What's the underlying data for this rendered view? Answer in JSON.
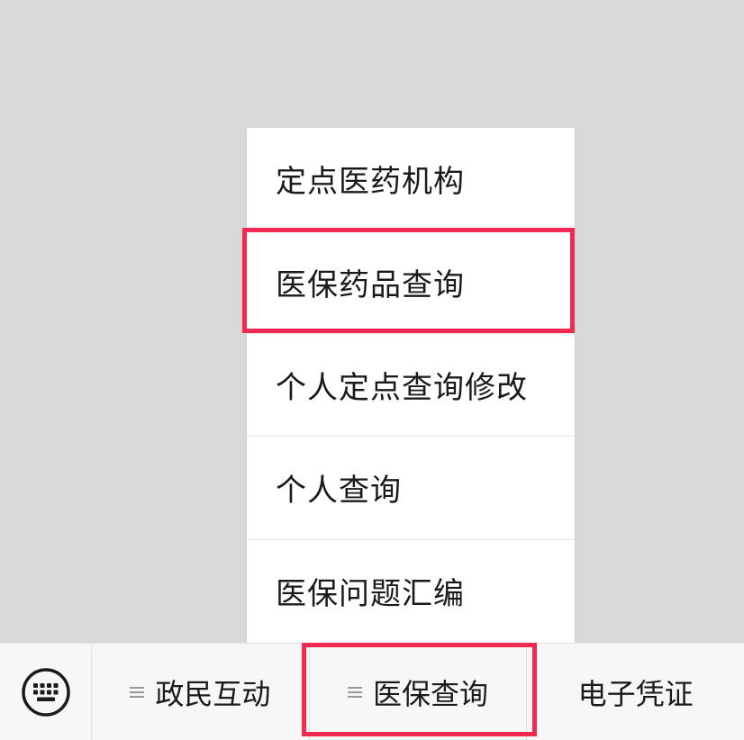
{
  "submenu": {
    "items": [
      {
        "label": "定点医药机构"
      },
      {
        "label": "医保药品查询"
      },
      {
        "label": "个人定点查询修改"
      },
      {
        "label": "个人查询"
      },
      {
        "label": "医保问题汇编"
      }
    ],
    "highlighted_index": 1
  },
  "menubar": {
    "keyboard_icon": "keyboard-icon",
    "menu_icon": "menu-lines-icon",
    "tabs": [
      {
        "label": "政民互动",
        "has_submenu": true
      },
      {
        "label": "医保查询",
        "has_submenu": true
      },
      {
        "label": "电子凭证",
        "has_submenu": false
      }
    ],
    "highlighted_index": 1
  },
  "colors": {
    "background": "#d9d9d9",
    "menu_bg": "#ffffff",
    "bar_bg": "#f7f7f7",
    "highlight": "#f22a52",
    "text": "#1a1a1a"
  }
}
